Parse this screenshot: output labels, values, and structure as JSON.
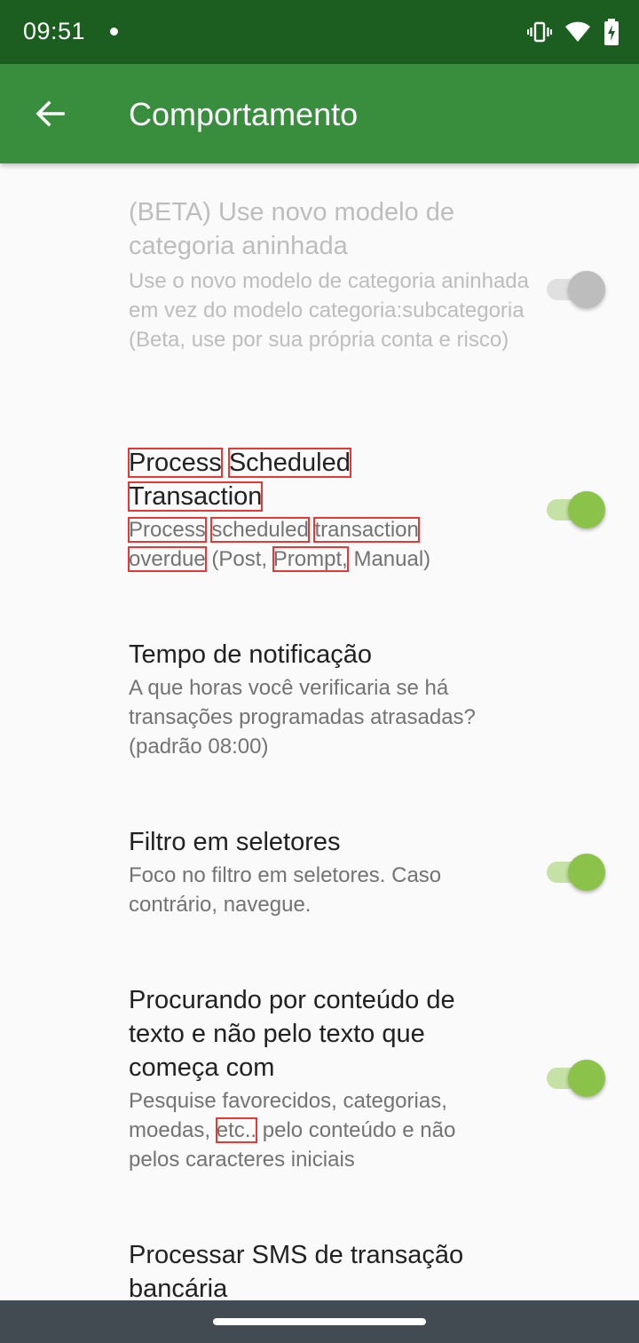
{
  "status_bar": {
    "time": "09:51",
    "icons": [
      "notification-dot-icon",
      "vibrate-icon",
      "wifi-icon",
      "battery-charging-icon"
    ]
  },
  "app_bar": {
    "title": "Comportamento",
    "back_icon": "arrow-back-icon"
  },
  "preferences": [
    {
      "title": "(BETA) Use novo modelo de categoria aninhada",
      "summary": "Use o novo modelo de categoria aninhada em vez do modelo categoria:subcategoria (Beta, use por sua própria conta e risco)",
      "switch": "off",
      "enabled": false
    },
    {
      "title_words": [
        "Process",
        "Scheduled",
        "Transaction"
      ],
      "summary_parts": [
        "Process",
        "scheduled",
        "transaction",
        "overdue",
        "(Post,",
        "Prompt,",
        "Manual)"
      ],
      "switch": "on",
      "enabled": true
    },
    {
      "title": "Tempo de notificação",
      "summary": "A que horas você verificaria se há transações programadas atrasadas? (padrão 08:00)",
      "enabled": true
    },
    {
      "title": "Filtro em seletores",
      "summary": "Foco no filtro em seletores. Caso contrário, navegue.",
      "switch": "on",
      "enabled": true
    },
    {
      "title": "Procurando por conteúdo de texto e não pelo texto que começa com",
      "summary_parts": [
        "Pesquise favorecidos, categorias, moedas,",
        "etc..",
        "pelo conteúdo e não pelos caracteres iniciais"
      ],
      "switch": "on",
      "enabled": true
    },
    {
      "title": "Processar SMS de transação bancária",
      "enabled": true
    }
  ],
  "colors": {
    "status_bar": "#1b5e20",
    "app_bar": "#388e3c",
    "switch_on_thumb": "#8bc34a",
    "switch_on_track": "#c5e1a5",
    "highlight_box": "#e53935"
  }
}
